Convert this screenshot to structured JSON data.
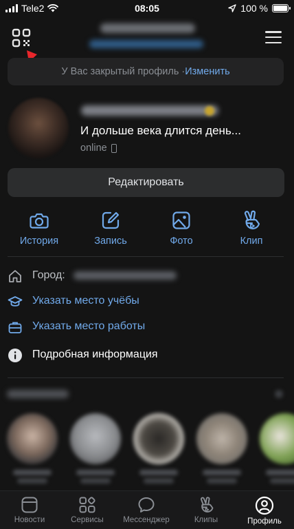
{
  "status_bar": {
    "carrier": "Tele2",
    "time": "08:05",
    "battery": "100 %"
  },
  "header": {
    "qr_icon": "qr-code-icon",
    "menu_icon": "hamburger-menu-icon"
  },
  "privacy_banner": {
    "text": "У Вас закрытый профиль · ",
    "link": "Изменить"
  },
  "profile": {
    "status": "И дольше века длится день...",
    "online": "online",
    "edit_label": "Редактировать"
  },
  "actions": [
    {
      "label": "История",
      "icon": "camera-icon"
    },
    {
      "label": "Запись",
      "icon": "edit-icon"
    },
    {
      "label": "Фото",
      "icon": "image-icon"
    },
    {
      "label": "Клип",
      "icon": "clip-icon"
    }
  ],
  "info": {
    "city_label": "Город:",
    "study_label": "Указать место учёбы",
    "work_label": "Указать место работы",
    "details_label": "Подробная информация"
  },
  "tabs": [
    {
      "label": "Новости",
      "icon": "news-icon"
    },
    {
      "label": "Сервисы",
      "icon": "services-icon"
    },
    {
      "label": "Мессенджер",
      "icon": "messenger-icon"
    },
    {
      "label": "Клипы",
      "icon": "clips-icon"
    },
    {
      "label": "Профиль",
      "icon": "profile-icon",
      "active": true
    }
  ],
  "colors": {
    "accent": "#71aaeb",
    "background": "#141414",
    "annotation_arrow": "#e8262b"
  }
}
